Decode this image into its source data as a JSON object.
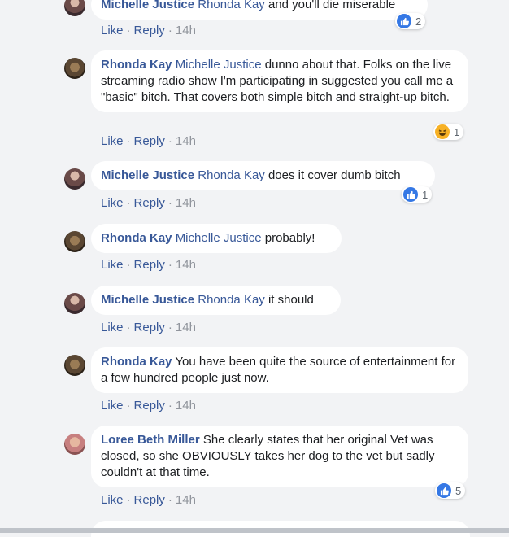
{
  "actions": {
    "like": "Like",
    "reply": "Reply",
    "separator": "·"
  },
  "comments": [
    {
      "author": "Michelle Justice",
      "mention": "Rhonda Kay",
      "text": "and you'll die miserable",
      "time": "14h",
      "reaction": {
        "type": "like",
        "count": "2"
      }
    },
    {
      "author": "Rhonda Kay",
      "mention": "Michelle Justice",
      "text": "dunno about that. Folks on the live streaming radio show I'm participating in suggested you call me a \"basic\" bitch. That covers both simple bitch and straight-up bitch.",
      "time": "14h",
      "reaction": {
        "type": "haha",
        "count": "1"
      }
    },
    {
      "author": "Michelle Justice",
      "mention": "Rhonda Kay",
      "text": "does it cover dumb bitch",
      "time": "14h",
      "reaction": {
        "type": "like",
        "count": "1"
      }
    },
    {
      "author": "Rhonda Kay",
      "mention": "Michelle Justice",
      "text": "probably!",
      "time": "14h"
    },
    {
      "author": "Michelle Justice",
      "mention": "Rhonda Kay",
      "text": "it should",
      "time": "14h"
    },
    {
      "author": "Rhonda Kay",
      "mention": "",
      "text": "You have been quite the source of entertainment for a few hundred people just now.",
      "time": "14h"
    },
    {
      "author": "Loree Beth Miller",
      "mention": "",
      "text": "She clearly states that her original Vet was closed, so she OBVIOUSLY takes her dog to the vet but sadly couldn't at that time.",
      "time": "14h",
      "reaction": {
        "type": "like",
        "count": "5"
      }
    }
  ],
  "colors": {
    "link": "#385898",
    "meta": "#90949c",
    "like": "#3578e5",
    "haha": "#f7b125",
    "background": "#f2f3f5"
  }
}
